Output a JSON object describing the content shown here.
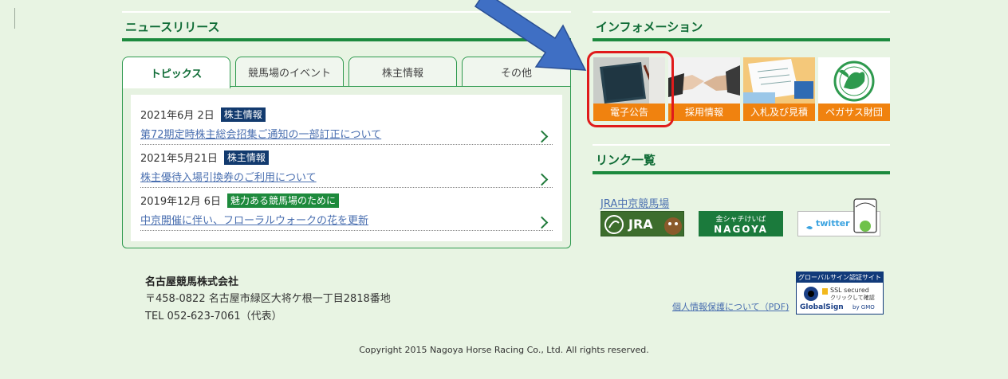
{
  "news": {
    "heading": "ニュースリリース",
    "tabs": [
      {
        "label": "トピックス"
      },
      {
        "label": "競馬場のイベント"
      },
      {
        "label": "株主情報"
      },
      {
        "label": "その他"
      }
    ],
    "items": [
      {
        "date": "2021年6月 2日",
        "badge": "株主情報",
        "title": "第72期定時株主総会招集ご通知の一部訂正について"
      },
      {
        "date": "2021年5月21日",
        "badge": "株主情報",
        "title": "株主優待入場引換券のご利用について"
      },
      {
        "date": "2019年12月 6日",
        "badge": "魅力ある競馬場のために",
        "title": "中京開催に伴い、フローラルウォークの花を更新"
      }
    ]
  },
  "info": {
    "heading": "インフォメーション",
    "tiles": [
      {
        "label": "電子公告"
      },
      {
        "label": "採用情報"
      },
      {
        "label": "入札及び見積"
      },
      {
        "label": "ペガサス財団"
      }
    ]
  },
  "links": {
    "heading": "リンク一覧",
    "jra_text": "JRA中京競馬場",
    "jra_logo": "JRA",
    "nagoya_line1": "金シャチけいば",
    "nagoya_line2": "NAGOYA",
    "twitter": "twitter"
  },
  "footer": {
    "company": "名古屋競馬株式会社",
    "address": "〒458-0822 名古屋市緑区大将ケ根一丁目2818番地",
    "tel": "TEL 052-623-7061（代表）",
    "privacy": "個人情報保護について（PDF)",
    "ssl_title": "グローバルサイン認証サイト",
    "ssl_line1": "SSL secured",
    "ssl_line2": "クリックして確認",
    "ssl_brand": "GlobalSign",
    "ssl_by": "by GMO",
    "copyright": "Copyright 2015 Nagoya Horse Racing Co., Ltd. All rights reserved."
  },
  "colors": {
    "accent_green": "#1c8a3e",
    "tile_orange": "#f0820f",
    "highlight_red": "#e01b1b",
    "arrow_blue": "#3f6fc4"
  }
}
